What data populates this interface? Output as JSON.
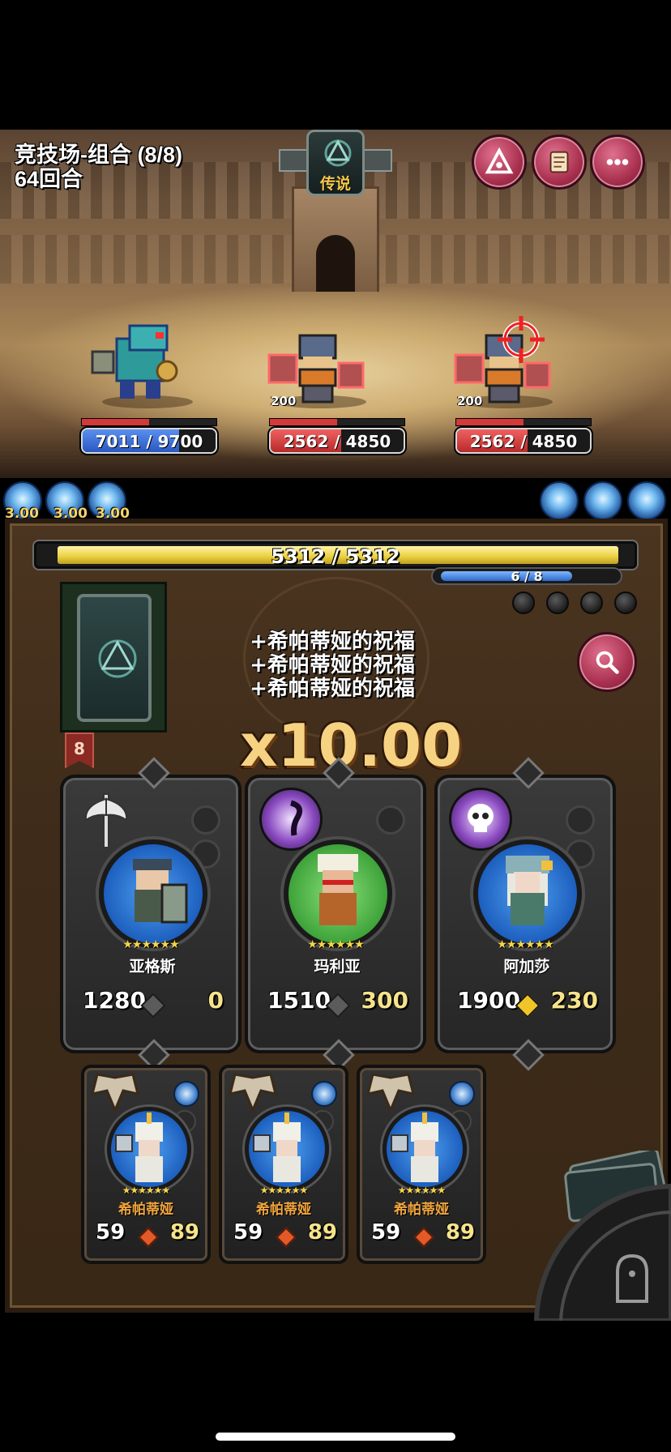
{
  "header": {
    "title": "竞技场-组合 (8/8)",
    "round": "64回合",
    "legend_badge": "传说"
  },
  "top_buttons": [
    {
      "name": "triangle-icon"
    },
    {
      "name": "scroll-icon"
    },
    {
      "name": "more-icon"
    }
  ],
  "units": [
    {
      "name": "dragon-knight",
      "hp": "7011",
      "max_hp": "9700",
      "hp_fraction": 0.7228,
      "level": ""
    },
    {
      "name": "dwarf-warrior-1",
      "hp": "2562",
      "max_hp": "4850",
      "hp_fraction": 0.5282,
      "level": "200"
    },
    {
      "name": "dwarf-warrior-2",
      "hp": "2562",
      "max_hp": "4850",
      "hp_fraction": 0.5282,
      "level": "200",
      "targeted": true
    }
  ],
  "speed_orbs_left": [
    "3.00",
    "3.00",
    "3.00"
  ],
  "speed_orbs_right_count": 3,
  "boss_hp": {
    "text": "5312 / 5312",
    "fraction": 1.0
  },
  "mana": {
    "text": "6 / 8",
    "fraction": 0.75
  },
  "deck": {
    "count": "8"
  },
  "blessings": [
    "+希帕蒂娅的祝福",
    "+希帕蒂娅的祝福",
    "+希帕蒂娅的祝福"
  ],
  "multiplier": "x10.00",
  "heroes": [
    {
      "name": "亚格斯",
      "atk": "1280",
      "hp": "0",
      "stars": "★★★★★★",
      "class_icon": "axe-icon",
      "ring": "#2f7fd8",
      "cost_color": "#5b5b5b"
    },
    {
      "name": "玛利亚",
      "atk": "1510",
      "hp": "300",
      "stars": "★★★★★★",
      "class_icon": "dark-orb-icon",
      "ring": "#4fc24a",
      "cost_color": "#5b5b5b"
    },
    {
      "name": "阿加莎",
      "atk": "1900",
      "hp": "230",
      "stars": "★★★★★★",
      "class_icon": "skull-icon",
      "ring": "#2f7fd8",
      "cost_color": "#f0c52a"
    }
  ],
  "hand": [
    {
      "name": "希帕蒂娅",
      "atk": "59",
      "hp": "89",
      "stars": "★★★★★★"
    },
    {
      "name": "希帕蒂娅",
      "atk": "59",
      "hp": "89",
      "stars": "★★★★★★"
    },
    {
      "name": "希帕蒂娅",
      "atk": "59",
      "hp": "89",
      "stars": "★★★★★★"
    }
  ],
  "colors": {
    "accent": "#f6d283",
    "board": "#3e2b19",
    "menu_button": "#b83a5a"
  }
}
